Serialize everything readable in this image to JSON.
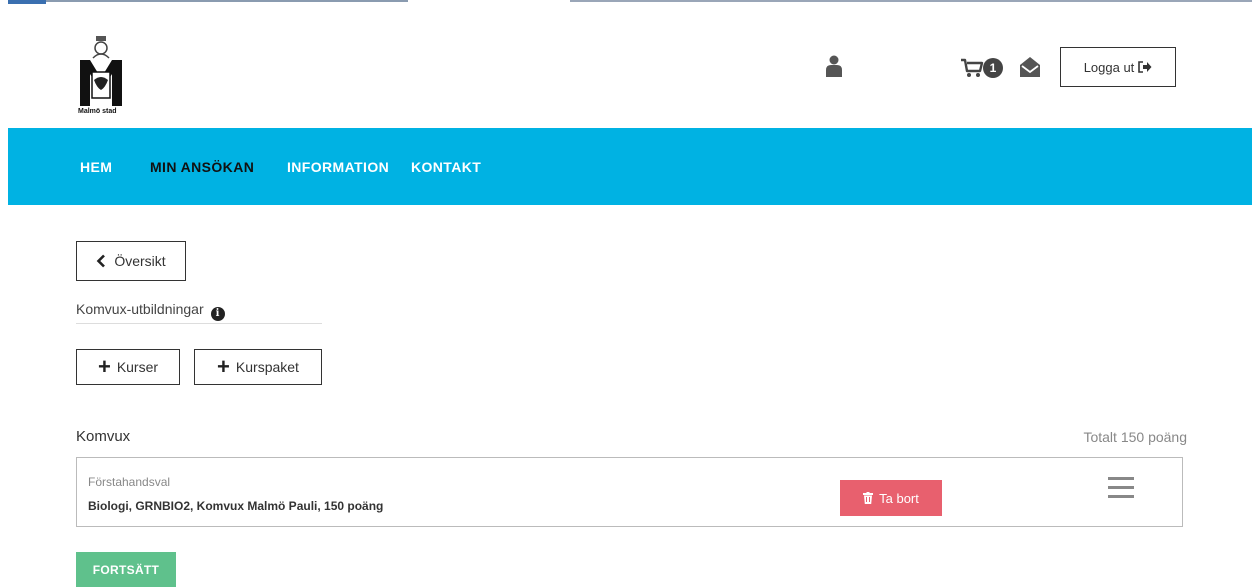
{
  "header": {
    "logo_text": "Malmö stad",
    "cart_count": "1",
    "logout_label": "Logga ut"
  },
  "nav": {
    "items": [
      {
        "label": "HEM",
        "active": false
      },
      {
        "label": "MIN ANSÖKAN",
        "active": true
      },
      {
        "label": "INFORMATION",
        "active": false
      },
      {
        "label": "KONTAKT",
        "active": false
      }
    ]
  },
  "overview_label": "Översikt",
  "section": {
    "title": "Komvux-utbildningar",
    "add_course_label": "Kurser",
    "add_package_label": "Kurspaket"
  },
  "list": {
    "heading": "Komvux",
    "total": "Totalt 150 poäng",
    "choices": [
      {
        "kind": "Förstahandsval",
        "course": "Biologi, GRNBIO2, Komvux Malmö Pauli, 150 poäng",
        "remove_label": "Ta bort"
      }
    ]
  },
  "continue_label": "FORTSÄTT",
  "colors": {
    "nav_bg": "#00b2e3",
    "remove_bg": "#e8606e",
    "continue_bg": "#5fc18c"
  },
  "icons": [
    "user-icon",
    "cart-icon",
    "mail-icon",
    "logout-icon",
    "chevron-left-icon",
    "info-icon",
    "plus-icon",
    "trash-icon",
    "drag-handle-icon"
  ]
}
